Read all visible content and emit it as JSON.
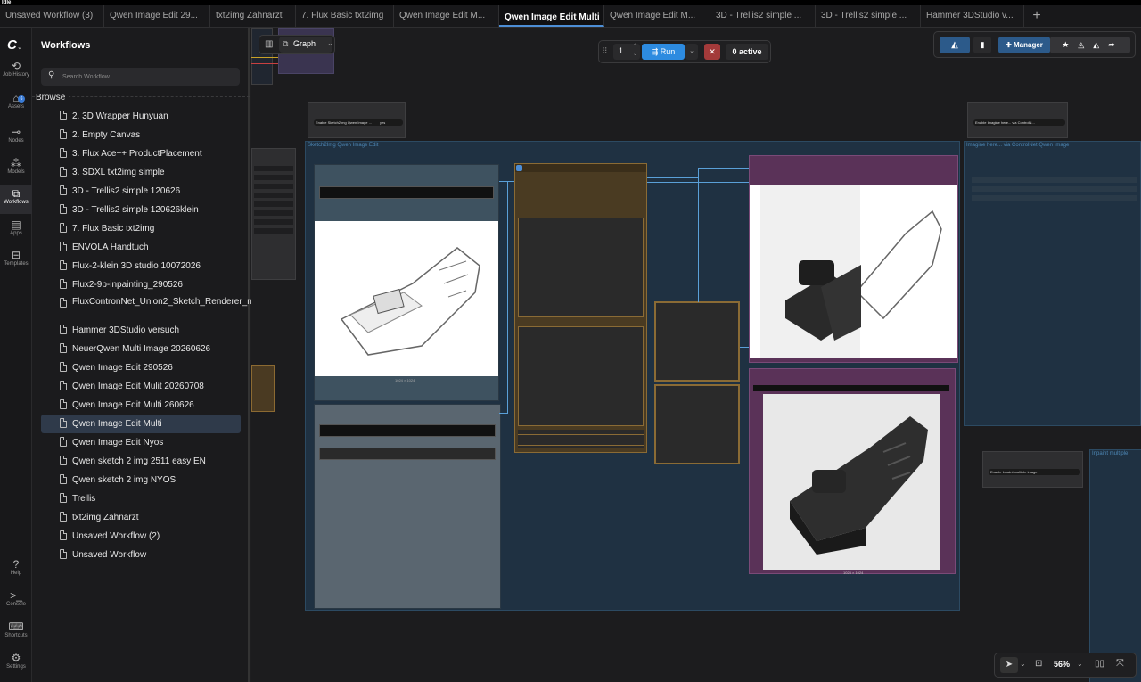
{
  "app": {
    "title": "Idle"
  },
  "tabs": [
    {
      "label": "Unsaved Workflow (3)"
    },
    {
      "label": "Qwen Image Edit 29..."
    },
    {
      "label": "txt2img Zahnarzt"
    },
    {
      "label": "7. Flux Basic txt2img"
    },
    {
      "label": "Qwen Image Edit M..."
    },
    {
      "label": "Qwen Image Edit Multi",
      "active": true
    },
    {
      "label": "Qwen Image Edit M..."
    },
    {
      "label": "3D - Trellis2 simple ..."
    },
    {
      "label": "3D - Trellis2 simple ..."
    },
    {
      "label": "Hammer 3DStudio v..."
    }
  ],
  "rail": {
    "job_history": "Job History",
    "assets": "Assets",
    "assets_badge": "6",
    "nodes": "Nodes",
    "models": "Models",
    "workflows": "Workflows",
    "apps": "Apps",
    "templates": "Templates",
    "help": "Help",
    "console": "Console",
    "shortcuts": "Shortcuts",
    "settings": "Settings"
  },
  "sidebar": {
    "title": "Workflows",
    "search_placeholder": "Search Workflow...",
    "browse": "Browse",
    "items": [
      "2. 3D Wrapper Hunyuan",
      "2. Empty Canvas",
      "3. Flux Ace++ ProductPlacement",
      "3. SDXL txt2img simple",
      "3D - Trellis2 simple 120626",
      "3D - Trellis2 simple 120626klein",
      "7. Flux Basic txt2img",
      "ENVOLA Handtuch",
      "Flux-2-klein 3D studio 10072026",
      "Flux2-9b-inpainting_290526",
      "FluxContronNet_Union2_Sketch_Renderer_nordy",
      "Hammer 3DStudio versuch",
      "NeuerQwen Multi Image 20260626",
      "Qwen Image Edit 290526",
      "Qwen Image Edit Mulit 20260708",
      "Qwen Image Edit Multi 260626",
      "Qwen Image Edit Multi",
      "Qwen Image Edit Nyos",
      "Qwen sketch 2 img 2511 easy EN",
      "Qwen sketch 2 img NYOS",
      "Trellis",
      "txt2img Zahnarzt",
      "Unsaved Workflow (2)",
      "Unsaved Workflow"
    ],
    "selected_index": 16
  },
  "toolbar": {
    "graph_label": "Graph",
    "run_count": "1",
    "run_label": "Run",
    "active_label": "0 active",
    "manager_label": "Manager"
  },
  "canvas": {
    "group1_title": "Sketch2Img Qwen Image Edit",
    "group2_title": "Imagine here... via ControlNet Qwen Image",
    "group3_title": "Inpaint multiple",
    "toggle1": "Enable Sketch2Img Qwen Image ...",
    "toggle1_value": "yes",
    "toggle2": "Enable Imagine here... via ControlN...",
    "toggle3": "Enable Inpaint multiple image",
    "preview1_caption": "1024 × 1024",
    "preview2_caption": "1024 × 1024"
  },
  "bottombar": {
    "zoom": "56%"
  }
}
